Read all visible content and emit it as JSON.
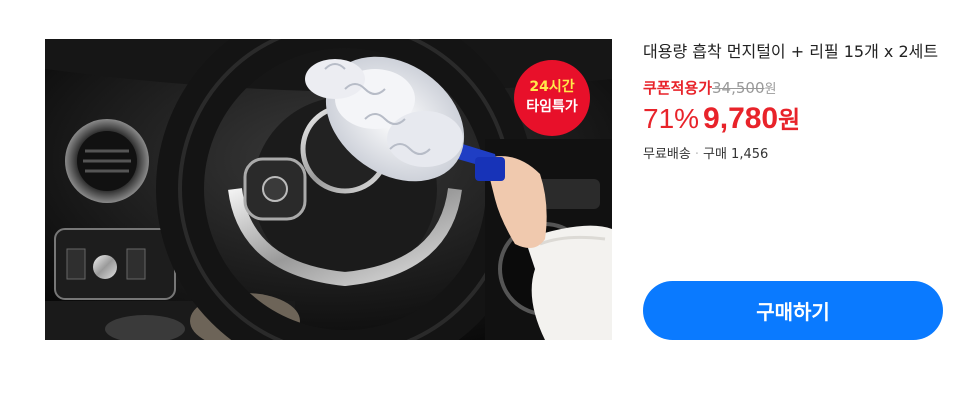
{
  "product": {
    "title": "대용량 흡착 먼지털이 + 리필 15개 x 2세트",
    "image_alt": "차량용 먼지털이로 스티어링 휠을 청소하는 모습",
    "badge": {
      "line1": "24시간",
      "line2": "타임특가"
    },
    "coupon_label": "쿠폰적용가",
    "original_price": "34,500",
    "original_currency": "원",
    "discount_rate": "71%",
    "sale_price": "9,780",
    "sale_currency": "원",
    "shipping": "무료배송",
    "purchase_label": "구매",
    "purchase_count": "1,456"
  },
  "actions": {
    "buy_label": "구매하기"
  },
  "colors": {
    "accent": "#e8232a",
    "button": "#0a7aff",
    "badge": "#e8102a"
  }
}
